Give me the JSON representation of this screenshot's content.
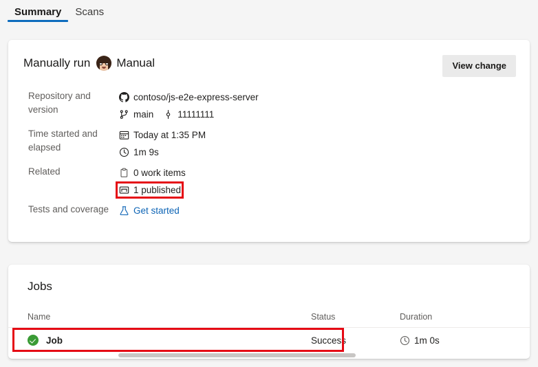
{
  "tabs": [
    {
      "label": "Summary",
      "active": true
    },
    {
      "label": "Scans",
      "active": false
    }
  ],
  "summary_card": {
    "run_title": "Manually run",
    "avatar_icon": "user-avatar",
    "actor": "Manual",
    "view_change_label": "View change",
    "rows": [
      {
        "label": "Repository and version",
        "lines": [
          {
            "icon": "github-icon",
            "text": "contoso/js-e2e-express-server"
          },
          {
            "icon": "branch-icon",
            "text": "main",
            "icon2": "commit-icon",
            "text2": "11111111"
          }
        ]
      },
      {
        "label": "Time started and elapsed",
        "lines": [
          {
            "icon": "calendar-icon",
            "text": "Today at 1:35 PM"
          },
          {
            "icon": "clock-icon",
            "text": "1m 9s"
          }
        ]
      },
      {
        "label": "Related",
        "lines": [
          {
            "icon": "clipboard-icon",
            "text": "0 work items"
          },
          {
            "icon": "artifact-icon",
            "text": "1 published",
            "highlighted": true
          }
        ]
      },
      {
        "label": "Tests and coverage",
        "lines": [
          {
            "icon": "beaker-icon",
            "text": "Get started",
            "link": true
          }
        ]
      }
    ]
  },
  "jobs_card": {
    "title": "Jobs",
    "columns": [
      "Name",
      "Status",
      "Duration"
    ],
    "rows": [
      {
        "status_icon": "success-check-icon",
        "name": "Job",
        "status": "Success",
        "duration_icon": "clock-icon",
        "duration": "1m 0s",
        "highlighted": true
      }
    ]
  },
  "colors": {
    "accent": "#0d6cbd",
    "link": "#0d64b5",
    "highlight": "#e50914",
    "success": "#3a9b35",
    "page_bg": "#f5f5f5",
    "card_bg": "#ffffff",
    "label_text": "#605e5c"
  }
}
